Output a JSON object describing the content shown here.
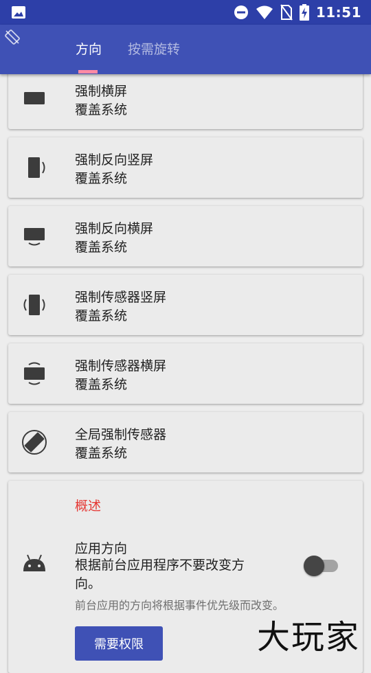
{
  "status_bar": {
    "time": "11:51"
  },
  "tabs": [
    {
      "label": "方向"
    },
    {
      "label": "按需旋转"
    }
  ],
  "items": [
    {
      "title": "强制横屏",
      "subtitle": "覆盖系统",
      "icon": "landscape-icon"
    },
    {
      "title": "强制反向竖屏",
      "subtitle": "覆盖系统",
      "icon": "reverse-portrait-icon"
    },
    {
      "title": "强制反向横屏",
      "subtitle": "覆盖系统",
      "icon": "reverse-landscape-icon"
    },
    {
      "title": "强制传感器竖屏",
      "subtitle": "覆盖系统",
      "icon": "sensor-portrait-icon"
    },
    {
      "title": "强制传感器横屏",
      "subtitle": "覆盖系统",
      "icon": "sensor-landscape-icon"
    },
    {
      "title": "全局强制传感器",
      "subtitle": "覆盖系统",
      "icon": "full-sensor-icon"
    }
  ],
  "overview": {
    "section_label": "概述",
    "app_orientation_title": "应用方向",
    "app_orientation_summary": "根据前台应用程序不要改变方向。",
    "hint": "前台应用的方向将根据事件优先级而改变。",
    "toggle_on": false,
    "permission_button": "需要权限"
  },
  "watermark": "大玩家",
  "colors": {
    "status_bar": "#2d3fa8",
    "app_bar": "#3f51b5",
    "accent_red": "#e53935",
    "tab_indicator": "#ff8aa4"
  }
}
